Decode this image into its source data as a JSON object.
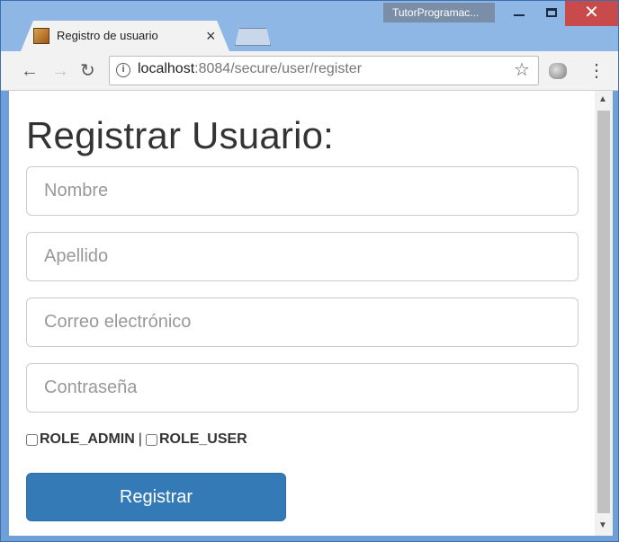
{
  "window": {
    "profile_name": "TutorProgramac...",
    "tab_title": "Registro de usuario"
  },
  "toolbar": {
    "url_host": "localhost",
    "url_rest": ":8084/secure/user/register"
  },
  "page": {
    "title": "Registrar Usuario:",
    "fields": {
      "nombre_placeholder": "Nombre",
      "apellido_placeholder": "Apellido",
      "correo_placeholder": "Correo electrónico",
      "password_placeholder": "Contraseña"
    },
    "roles": {
      "admin_label": "ROLE_ADMIN",
      "separator": "|",
      "user_label": "ROLE_USER"
    },
    "submit_label": "Registrar"
  },
  "colors": {
    "primary_button": "#337ab7",
    "window_close": "#c84a4a"
  },
  "icons": {
    "back": "arrow-left-icon",
    "forward": "arrow-right-icon",
    "reload": "reload-icon",
    "info": "info-icon",
    "star": "star-icon",
    "menu": "kebab-menu-icon"
  }
}
